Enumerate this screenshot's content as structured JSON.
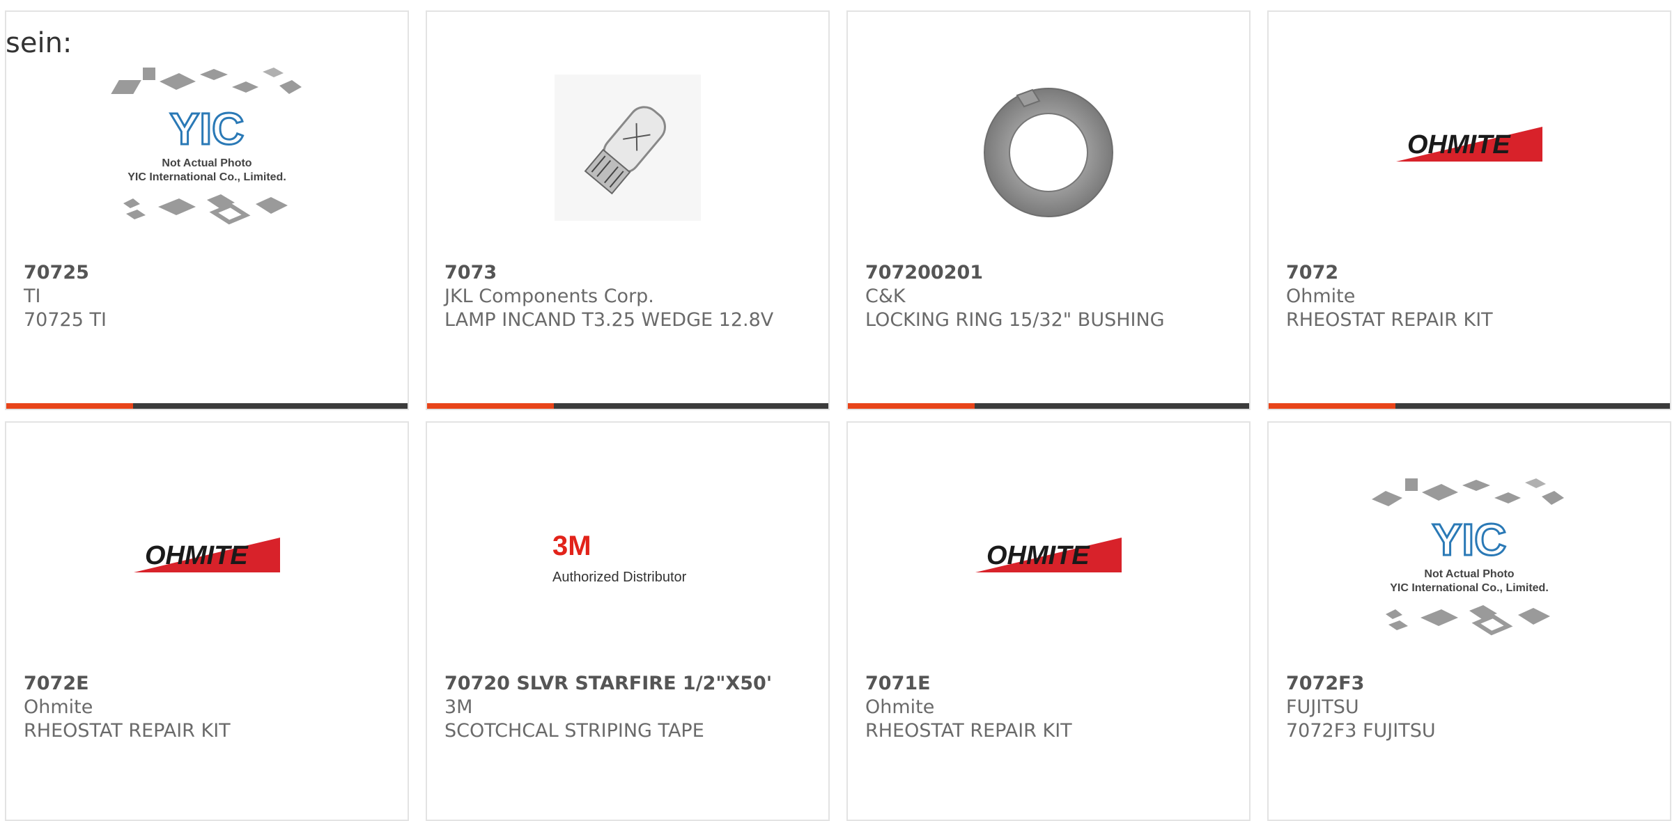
{
  "page": {
    "prefix_text": "sein:"
  },
  "products": [
    {
      "part": "70725",
      "manufacturer": "TI",
      "description": "70725 TI",
      "image": "yic-placeholder",
      "image_text": {
        "line1": "Not Actual Photo",
        "line2": "YIC International Co., Limited.",
        "logo": "YIC"
      }
    },
    {
      "part": "7073",
      "manufacturer": "JKL Components Corp.",
      "description": "LAMP INCAND T3.25 WEDGE 12.8V",
      "image": "wedge-lamp"
    },
    {
      "part": "707200201",
      "manufacturer": "C&K",
      "description": "LOCKING RING 15/32\" BUSHING",
      "image": "locking-ring"
    },
    {
      "part": "7072",
      "manufacturer": "Ohmite",
      "description": "RHEOSTAT REPAIR KIT",
      "image": "ohmite-logo",
      "image_text": {
        "logo": "OHMITE"
      }
    },
    {
      "part": "7072E",
      "manufacturer": "Ohmite",
      "description": "RHEOSTAT REPAIR KIT",
      "image": "ohmite-logo",
      "image_text": {
        "logo": "OHMITE"
      }
    },
    {
      "part": "70720 SLVR STARFIRE 1/2\"X50'",
      "manufacturer": "3M",
      "description": "SCOTCHCAL STRIPING TAPE",
      "image": "3m-logo",
      "image_text": {
        "logo": "3M",
        "line1": "Authorized Distributor"
      }
    },
    {
      "part": "7071E",
      "manufacturer": "Ohmite",
      "description": "RHEOSTAT REPAIR KIT",
      "image": "ohmite-logo",
      "image_text": {
        "logo": "OHMITE"
      }
    },
    {
      "part": "7072F3",
      "manufacturer": "FUJITSU",
      "description": "7072F3 FUJITSU",
      "image": "yic-placeholder",
      "image_text": {
        "line1": "Not Actual Photo",
        "line2": "YIC International Co., Limited.",
        "logo": "YIC"
      }
    }
  ],
  "colors": {
    "accent": "#e8441a",
    "bar": "#3b3b3b",
    "border": "#e3e3e3",
    "ohmite_red": "#d8222a"
  }
}
